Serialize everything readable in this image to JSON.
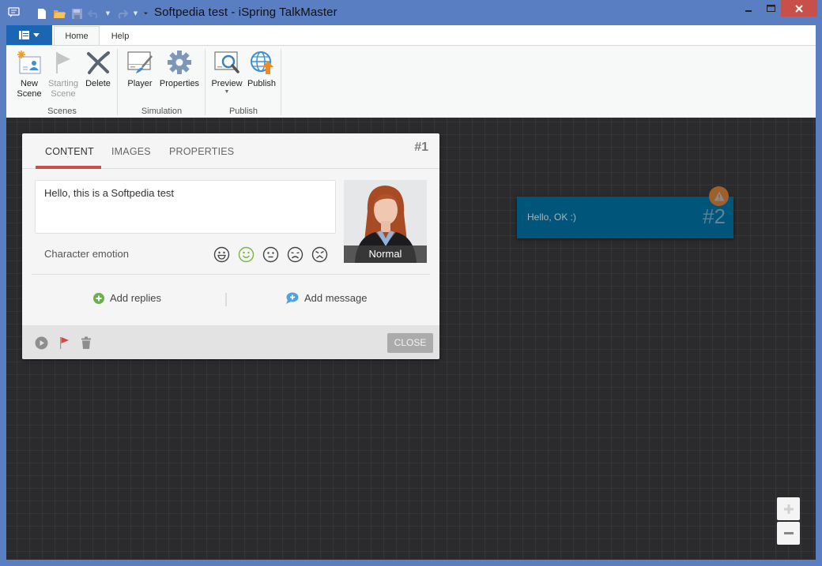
{
  "window": {
    "title": "Softpedia test - iSpring TalkMaster"
  },
  "ribbon": {
    "tabs": [
      {
        "label": "Home",
        "active": true
      },
      {
        "label": "Help",
        "active": false
      }
    ],
    "groups": [
      {
        "label": "Scenes",
        "buttons": [
          {
            "label_line1": "New",
            "label_line2": "Scene",
            "icon": "new-scene-icon",
            "enabled": true
          },
          {
            "label_line1": "Starting",
            "label_line2": "Scene",
            "icon": "flag-icon",
            "enabled": false
          },
          {
            "label_line1": "Delete",
            "label_line2": "",
            "icon": "delete-x-icon",
            "enabled": true
          }
        ]
      },
      {
        "label": "Simulation",
        "buttons": [
          {
            "label_line1": "Player",
            "icon": "player-icon",
            "enabled": true
          },
          {
            "label_line1": "Properties",
            "icon": "gear-icon",
            "enabled": true
          }
        ]
      },
      {
        "label": "Publish",
        "buttons": [
          {
            "label_line1": "Preview",
            "icon": "preview-magnifier-icon",
            "enabled": true,
            "has_dropdown": true
          },
          {
            "label_line1": "Publish",
            "icon": "globe-upload-icon",
            "enabled": true
          }
        ]
      }
    ]
  },
  "scene1": {
    "number": "#1",
    "tabs": [
      {
        "label": "CONTENT",
        "active": true
      },
      {
        "label": "IMAGES",
        "active": false
      },
      {
        "label": "PROPERTIES",
        "active": false
      }
    ],
    "message": "Hello, this is a Softpedia test",
    "emotion_label": "Character emotion",
    "emotions": [
      "happy",
      "smile",
      "normal",
      "sad",
      "angry"
    ],
    "selected_emotion": "smile",
    "character_caption": "Normal",
    "add_replies": "Add replies",
    "add_message": "Add message",
    "close_label": "CLOSE",
    "accent_color": "#c7504b"
  },
  "scene2": {
    "number": "#2",
    "message": "Hello, OK :)",
    "has_warning": true,
    "color": "#00557a"
  },
  "zoom": {
    "in_label": "+",
    "out_label": "−"
  }
}
